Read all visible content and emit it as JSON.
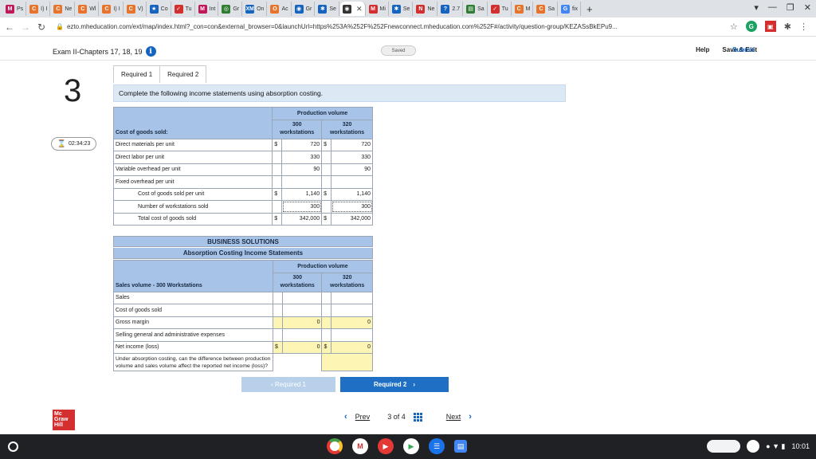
{
  "browser": {
    "tabs": [
      {
        "label": "Ps",
        "color": "#c2185b",
        "letter": "M"
      },
      {
        "label": "I) I",
        "color": "#e8742b",
        "letter": "C"
      },
      {
        "label": "Ne",
        "color": "#e8742b",
        "letter": "C"
      },
      {
        "label": "Wl",
        "color": "#e8742b",
        "letter": "C"
      },
      {
        "label": "I) I",
        "color": "#e8742b",
        "letter": "C"
      },
      {
        "label": "V)",
        "color": "#e8742b",
        "letter": "C"
      },
      {
        "label": "Co",
        "color": "#1565c0",
        "letter": "★"
      },
      {
        "label": "Tu",
        "color": "#d32f2f",
        "letter": "✓"
      },
      {
        "label": "Int",
        "color": "#c2185b",
        "letter": "M"
      },
      {
        "label": "Gr",
        "color": "#2e7d32",
        "letter": "◎"
      },
      {
        "label": "On",
        "color": "#1565c0",
        "letter": "XM"
      },
      {
        "label": "Ac",
        "color": "#e8742b",
        "letter": "O"
      },
      {
        "label": "Gr",
        "color": "#1565c0",
        "letter": "◉"
      },
      {
        "label": "Se",
        "color": "#1565c0",
        "letter": "✱"
      },
      {
        "label": "",
        "color": "#333333",
        "letter": "◉"
      },
      {
        "label": "Mi",
        "color": "#d32f2f",
        "letter": "M"
      },
      {
        "label": "Se",
        "color": "#1565c0",
        "letter": "✱"
      },
      {
        "label": "Ne",
        "color": "#d32f2f",
        "letter": "N"
      },
      {
        "label": "2.7",
        "color": "#1565c0",
        "letter": "?"
      },
      {
        "label": "Sa",
        "color": "#2e7d32",
        "letter": "▤"
      },
      {
        "label": "Tu",
        "color": "#d32f2f",
        "letter": "✓"
      },
      {
        "label": "M",
        "color": "#e8742b",
        "letter": "C"
      },
      {
        "label": "Sa",
        "color": "#e8742b",
        "letter": "C"
      },
      {
        "label": "fix",
        "color": "#4285f4",
        "letter": "G"
      }
    ],
    "url": "ezto.mheducation.com/ext/map/index.html?_con=con&external_browser=0&launchUrl=https%253A%252F%252Fnewconnect.mheducation.com%252F#/activity/question-group/KEZASsBkEPu9..."
  },
  "exam": {
    "title": "Exam II-Chapters 17, 18, 19",
    "saved": "Saved",
    "help": "Help",
    "save_exit": "Save & Exit",
    "submit": "Submit",
    "question_number": "3",
    "timer": "02:34:23"
  },
  "req_tabs": [
    "Required 1",
    "Required 2"
  ],
  "instruction": "Complete the following income statements using absorption costing.",
  "cogs_table": {
    "production_volume": "Production volume",
    "col1_top": "300",
    "col1_bottom": "workstations",
    "col2_top": "320",
    "col2_bottom": "workstations",
    "section_label": "Cost of goods sold:",
    "rows": [
      {
        "label": "Direct materials per unit",
        "cur1": "$",
        "v1": "720",
        "cur2": "$",
        "v2": "720"
      },
      {
        "label": "Direct labor per unit",
        "cur1": "",
        "v1": "330",
        "cur2": "",
        "v2": "330"
      },
      {
        "label": "Variable overhead per unit",
        "cur1": "",
        "v1": "90",
        "cur2": "",
        "v2": "90"
      },
      {
        "label": "Fixed overhead per unit",
        "cur1": "",
        "v1": "",
        "cur2": "",
        "v2": ""
      },
      {
        "label": "Cost of goods sold per unit",
        "cur1": "$",
        "v1": "1,140",
        "cur2": "$",
        "v2": "1,140"
      },
      {
        "label": "Number of workstations sold",
        "cur1": "",
        "v1": "300",
        "cur2": "",
        "v2": "300"
      },
      {
        "label": "Total cost of goods sold",
        "cur1": "$",
        "v1": "342,000",
        "cur2": "$",
        "v2": "342,000"
      }
    ]
  },
  "income_table": {
    "company": "BUSINESS SOLUTIONS",
    "statement": "Absorption Costing Income Statements",
    "production_volume": "Production volume",
    "col1_top": "300",
    "col1_bottom": "workstations",
    "col2_top": "320",
    "col2_bottom": "workstations",
    "section_label": "Sales volume - 300 Workstations",
    "rows": [
      {
        "label": "Sales",
        "cur1": "",
        "v1": "",
        "cur2": "",
        "v2": ""
      },
      {
        "label": "Cost of goods sold",
        "cur1": "",
        "v1": "",
        "cur2": "",
        "v2": ""
      },
      {
        "label": "Gross margin",
        "cur1": "",
        "v1": "0",
        "cur2": "",
        "v2": "0"
      },
      {
        "label": "Selling general and administrative expenses",
        "cur1": "",
        "v1": "",
        "cur2": "",
        "v2": ""
      },
      {
        "label": "Net income (loss)",
        "cur1": "$",
        "v1": "0",
        "cur2": "$",
        "v2": "0"
      }
    ],
    "question_line1": "Under absorption costing, can the difference between production",
    "question_line2": "volume and sales volume affect the reported net income (loss)?"
  },
  "nav": {
    "prev_req": "‹  Required 1",
    "next_req": "Required 2",
    "prev": "Prev",
    "page_current": "3",
    "page_of": "of 4",
    "next": "Next"
  },
  "logo": {
    "line1": "Mc",
    "line2": "Graw",
    "line3": "Hill"
  },
  "taskbar": {
    "time": "10:01"
  }
}
